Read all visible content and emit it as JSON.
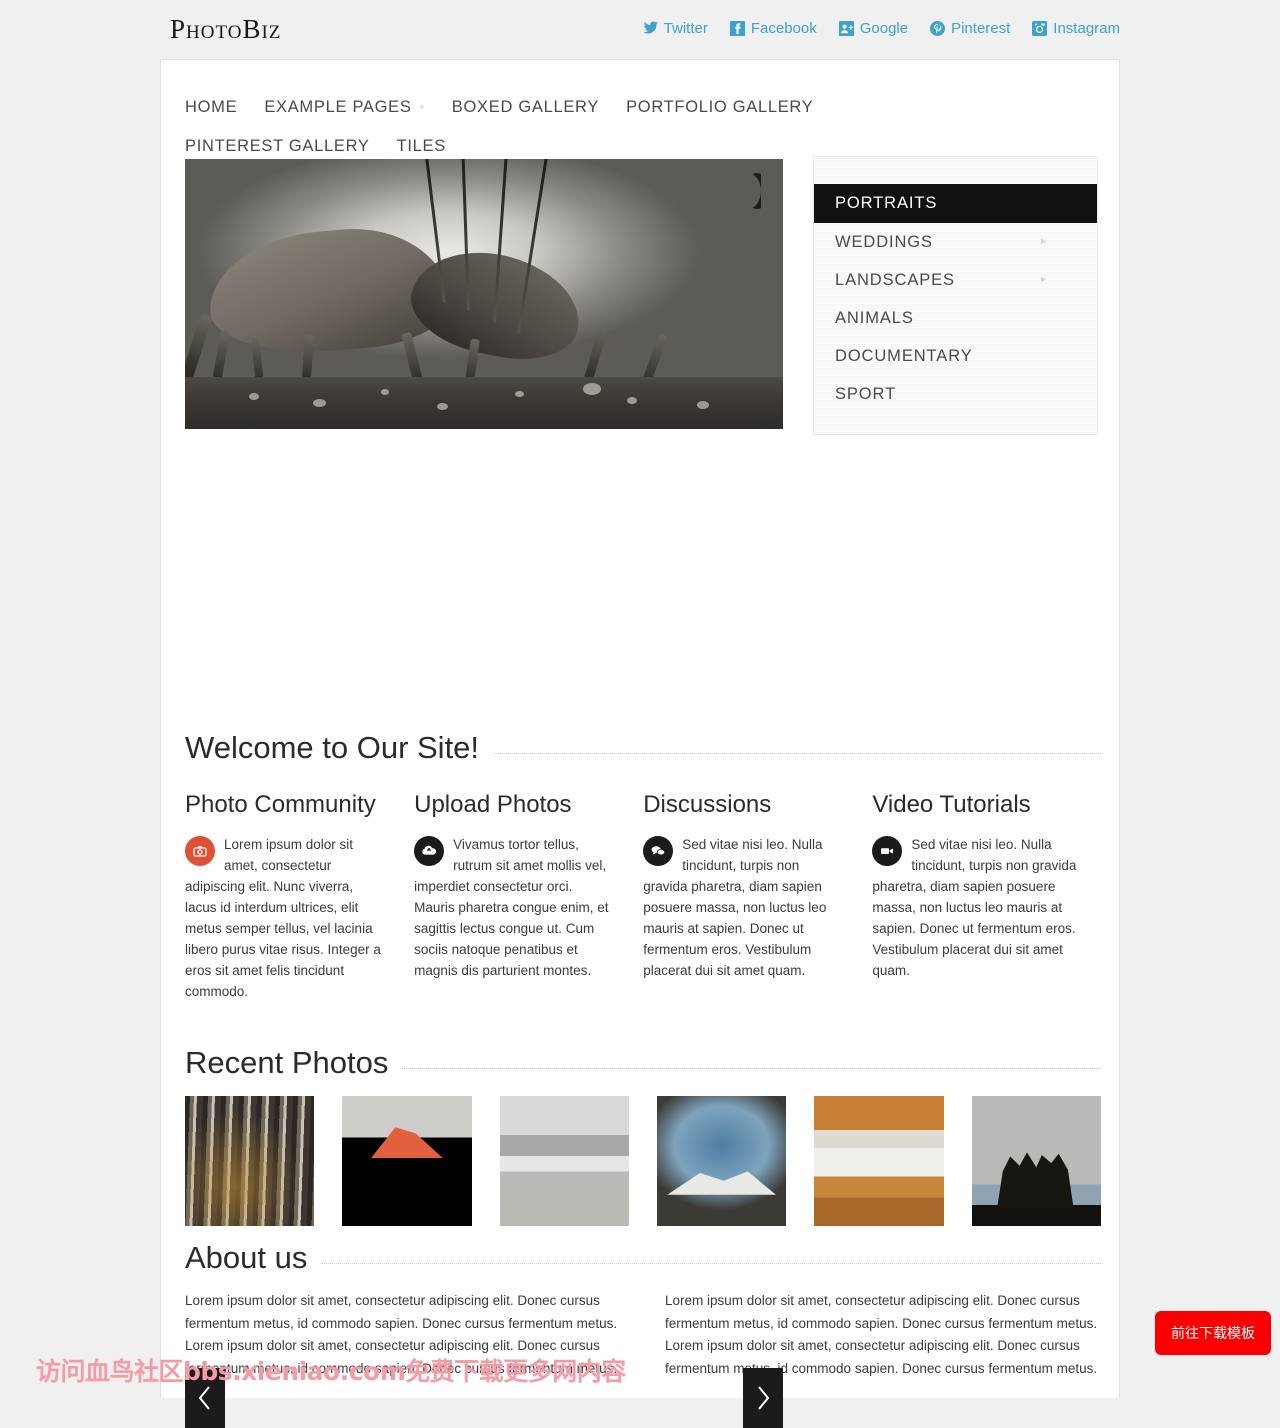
{
  "site": {
    "logo": "PhotoBiz",
    "accent_blue": "#3ba3cc",
    "accent_orange": "#dd5135",
    "active_black": "#111111",
    "page_bg": "#f0f0f0"
  },
  "social": [
    {
      "label": "Twitter",
      "icon": "twitter-icon"
    },
    {
      "label": "Facebook",
      "icon": "facebook-icon"
    },
    {
      "label": "Google",
      "icon": "google-plus-icon"
    },
    {
      "label": "Pinterest",
      "icon": "pinterest-icon"
    },
    {
      "label": "Instagram",
      "icon": "instagram-icon"
    }
  ],
  "nav": [
    {
      "label": "HOME",
      "caret": ""
    },
    {
      "label": "EXAMPLE PAGES",
      "caret": "▾"
    },
    {
      "label": "BOXED GALLERY",
      "caret": ""
    },
    {
      "label": "PORTFOLIO GALLERY",
      "caret": ""
    },
    {
      "label": "PINTEREST GALLERY",
      "caret": ""
    },
    {
      "label": "TILES",
      "caret": ""
    }
  ],
  "slider": {
    "prev_label": "‹",
    "next_label": "›",
    "image_alt": "two oryx antelope fighting in dust, black and white"
  },
  "categories": [
    {
      "label": "PORTRAITS",
      "active": true,
      "caret": ""
    },
    {
      "label": "WEDDINGS",
      "active": false,
      "caret": "▸"
    },
    {
      "label": "LANDSCAPES",
      "active": false,
      "caret": "▸"
    },
    {
      "label": "ANIMALS",
      "active": false,
      "caret": ""
    },
    {
      "label": "DOCUMENTARY",
      "active": false,
      "caret": ""
    },
    {
      "label": "SPORT",
      "active": false,
      "caret": ""
    }
  ],
  "welcome": {
    "title": "Welcome to Our Site!",
    "columns": [
      {
        "heading": "Photo Community",
        "icon": "camera-icon",
        "icon_color": "#dd5135",
        "text": "Lorem ipsum dolor sit amet, consectetur adipiscing elit. Nunc viverra, lacus id interdum ultrices, elit metus semper tellus, vel lacinia libero purus vitae risus. Integer a eros sit amet felis tincidunt commodo."
      },
      {
        "heading": "Upload Photos",
        "icon": "cloud-upload-icon",
        "icon_color": "#1b1b1b",
        "text": "Vivamus tortor tellus, rutrum sit amet mollis vel, imperdiet consectetur orci. Mauris pharetra congue enim, et sagittis lectus congue ut. Cum sociis natoque penatibus et magnis dis parturient montes."
      },
      {
        "heading": "Discussions",
        "icon": "comments-icon",
        "icon_color": "#1b1b1b",
        "text": "Sed vitae nisi leo. Nulla tincidunt, turpis non gravida pharetra, diam sapien posuere massa, non luctus leo mauris at sapien. Donec ut fermentum eros. Vestibulum placerat dui sit amet quam."
      },
      {
        "heading": "Video Tutorials",
        "icon": "video-camera-icon",
        "icon_color": "#1b1b1b",
        "text": "Sed vitae nisi leo. Nulla tincidunt, turpis non gravida pharetra, diam sapien posuere massa, non luctus leo mauris at sapien. Donec ut fermentum eros. Vestibulum placerat dui sit amet quam."
      }
    ]
  },
  "recent_photos": {
    "title": "Recent Photos",
    "items": [
      {
        "alt": "birch forest with golden autumn foliage"
      },
      {
        "alt": "red sunlit mountain peak above dark lake"
      },
      {
        "alt": "misty grey lake and forested hillside"
      },
      {
        "alt": "snowy mountain under blue sky reflected in lake"
      },
      {
        "alt": "lone tree in golden autumn field"
      },
      {
        "alt": "two bare tree silhouettes against grey sky"
      }
    ]
  },
  "about": {
    "title": "About us",
    "paragraphs": [
      "Lorem ipsum dolor sit amet, consectetur adipiscing elit. Donec cursus fermentum metus, id commodo sapien. Donec cursus fermentum metus. Lorem ipsum dolor sit amet, consectetur adipiscing elit. Donec cursus fermentum metus, id commodo sapien. Donec cursus fermentum metus.",
      "Lorem ipsum dolor sit amet, consectetur adipiscing elit. Donec cursus fermentum metus, id commodo sapien. Donec cursus fermentum metus. Lorem ipsum dolor sit amet, consectetur adipiscing elit. Donec cursus fermentum metus, id commodo sapien. Donec cursus fermentum metus."
    ]
  },
  "overlays": {
    "watermark": "访问血鸟社区bbs.xieniao.com免费下载更多网内容",
    "download_button": "前往下载模板"
  }
}
